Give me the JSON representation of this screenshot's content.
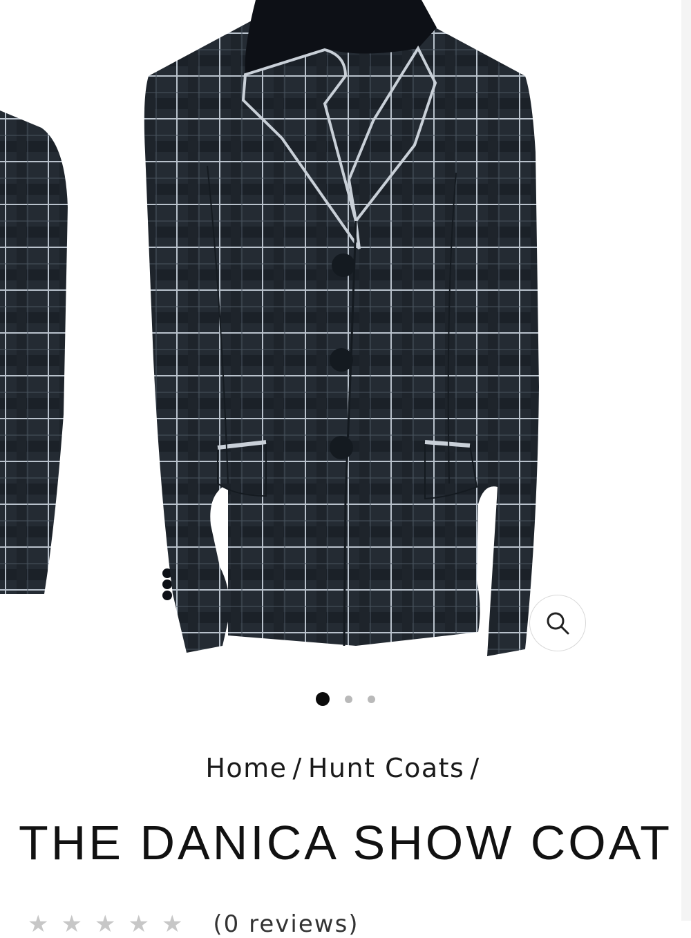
{
  "gallery": {
    "image_alt": "THE DANICA SHOW COAT",
    "slide_count": 3,
    "active_slide": 1,
    "zoom_icon": "search-icon"
  },
  "breadcrumb": {
    "home": "Home",
    "separator": "/",
    "category": "Hunt Coats"
  },
  "product": {
    "title": "THE DANICA SHOW COAT",
    "rating_stars": 0,
    "review_count_text": "(0 reviews)"
  },
  "colors": {
    "coat": "#262d35",
    "plaid_light": "#b9c2cc",
    "collar": "#0d1016",
    "piping": "#c9d0d8"
  }
}
